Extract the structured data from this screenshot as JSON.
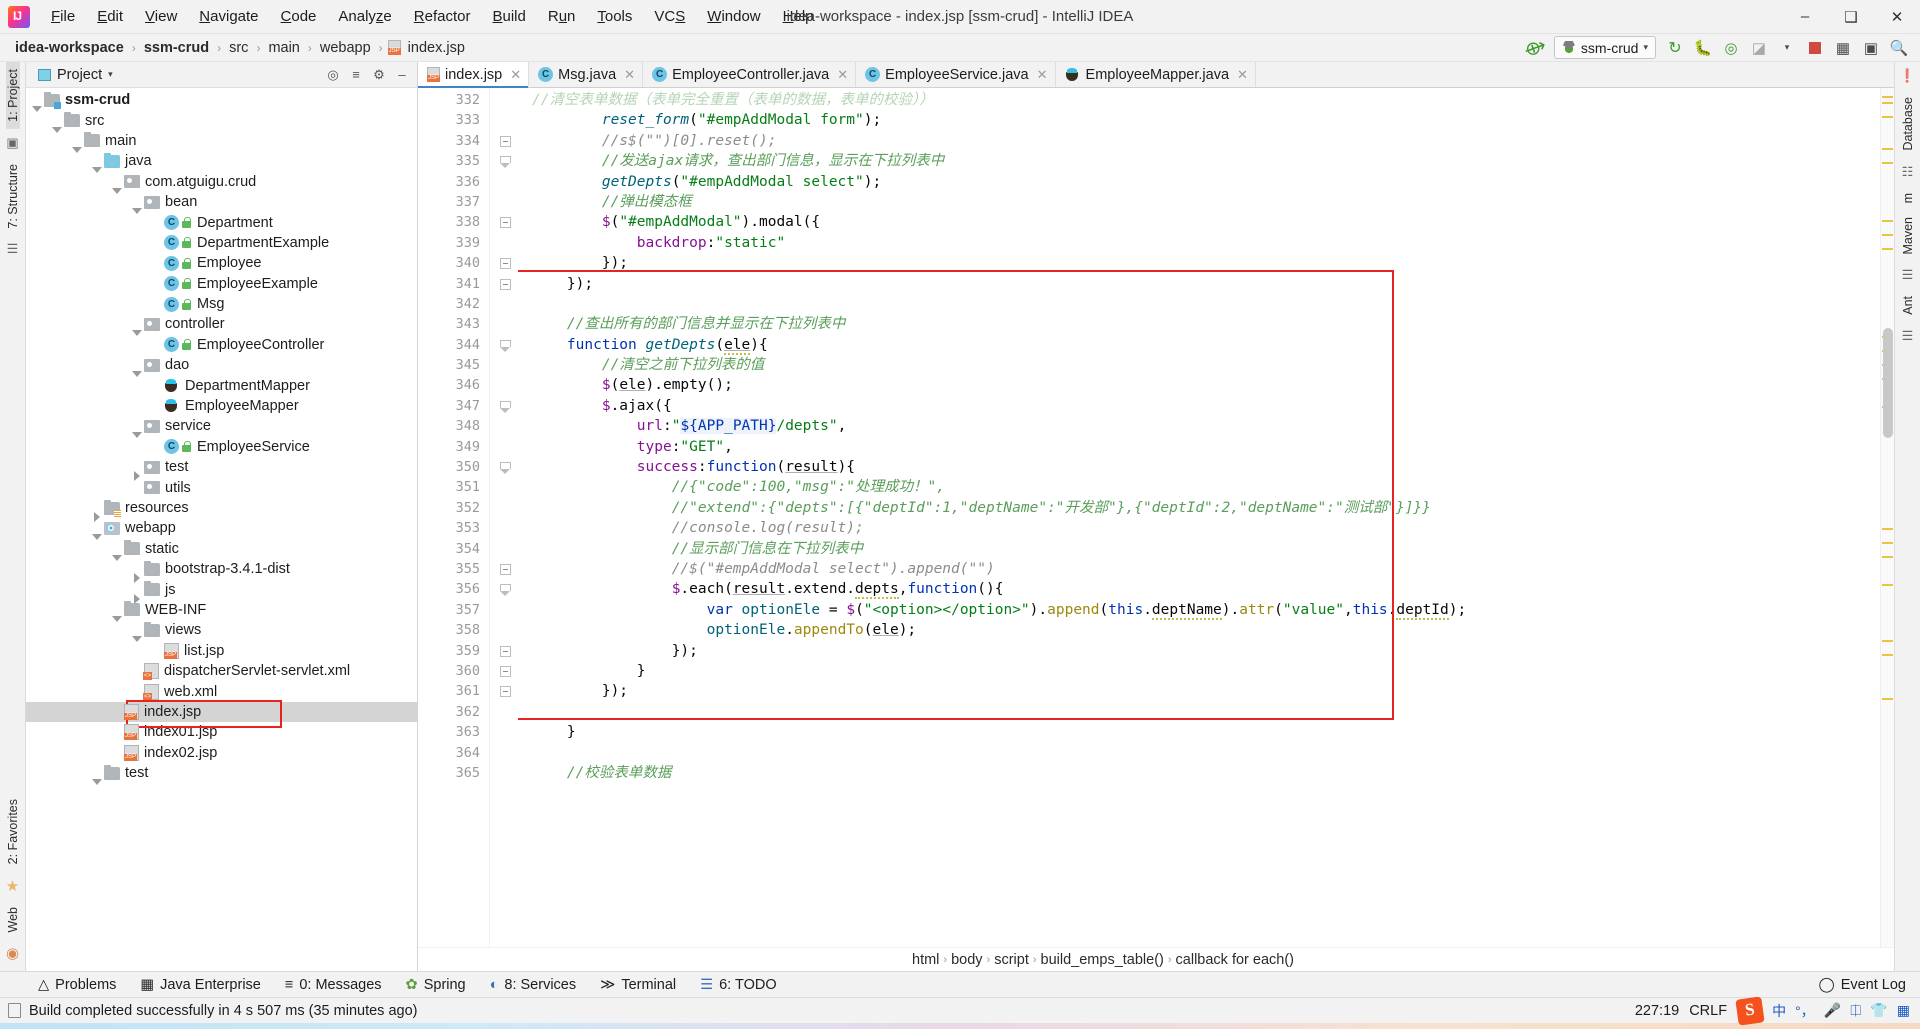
{
  "window": {
    "title": "idea-workspace - index.jsp [ssm-crud] - IntelliJ IDEA",
    "minimize": "–",
    "maximize": "❑",
    "close": "✕"
  },
  "menubar": [
    {
      "label": "File",
      "mnemonic": "F"
    },
    {
      "label": "Edit",
      "mnemonic": "E"
    },
    {
      "label": "View",
      "mnemonic": "V"
    },
    {
      "label": "Navigate",
      "mnemonic": "N"
    },
    {
      "label": "Code",
      "mnemonic": "C"
    },
    {
      "label": "Analyze",
      "mnemonic": "z"
    },
    {
      "label": "Refactor",
      "mnemonic": "R"
    },
    {
      "label": "Build",
      "mnemonic": "B"
    },
    {
      "label": "Run",
      "mnemonic": "u"
    },
    {
      "label": "Tools",
      "mnemonic": "T"
    },
    {
      "label": "VCS",
      "mnemonic": "S"
    },
    {
      "label": "Window",
      "mnemonic": "W"
    },
    {
      "label": "Help",
      "mnemonic": "H"
    }
  ],
  "breadcrumb": {
    "items": [
      "idea-workspace",
      "ssm-crud",
      "src",
      "main",
      "webapp",
      "index.jsp"
    ],
    "separator": "›"
  },
  "toolbar": {
    "run_config": "ssm-crud",
    "back_arrow_icon": "back-arrow-icon",
    "run_icon": "run-icon",
    "debug_icon": "debug-icon",
    "run_coverage_icon": "run-with-coverage-icon",
    "profile_icon": "profile-icon",
    "stop_icon": "stop-icon",
    "dropdown_caret": "▾",
    "project_structure_icon": "project-structure-icon",
    "layout_icon": "layout-icon",
    "search_icon": "search-everywhere-icon"
  },
  "left_rail": {
    "top": [
      "1: Project",
      "7: Structure"
    ],
    "bottom": [
      "2: Favorites",
      "Web"
    ]
  },
  "right_rail": {
    "items": [
      "Database",
      "m",
      "Maven",
      "Ant"
    ]
  },
  "project_panel": {
    "title": "Project",
    "caret": "▾",
    "header_icons": [
      "locate-icon",
      "collapse-all-icon",
      "settings-icon",
      "hide-icon"
    ],
    "tree": [
      {
        "depth": 0,
        "arrow": "down",
        "icon": "folder-module",
        "label": "ssm-crud",
        "bold": true
      },
      {
        "depth": 1,
        "arrow": "down",
        "icon": "folder-gray",
        "label": "src"
      },
      {
        "depth": 2,
        "arrow": "down",
        "icon": "folder-gray",
        "label": "main"
      },
      {
        "depth": 3,
        "arrow": "down",
        "icon": "folder-blue",
        "label": "java"
      },
      {
        "depth": 4,
        "arrow": "down",
        "icon": "package",
        "label": "com.atguigu.crud"
      },
      {
        "depth": 5,
        "arrow": "down",
        "icon": "package",
        "label": "bean"
      },
      {
        "depth": 6,
        "arrow": "none",
        "icon": "class",
        "label": "Department"
      },
      {
        "depth": 6,
        "arrow": "none",
        "icon": "class",
        "label": "DepartmentExample"
      },
      {
        "depth": 6,
        "arrow": "none",
        "icon": "class",
        "label": "Employee"
      },
      {
        "depth": 6,
        "arrow": "none",
        "icon": "class",
        "label": "EmployeeExample"
      },
      {
        "depth": 6,
        "arrow": "none",
        "icon": "class",
        "label": "Msg"
      },
      {
        "depth": 5,
        "arrow": "down",
        "icon": "package",
        "label": "controller"
      },
      {
        "depth": 6,
        "arrow": "none",
        "icon": "class",
        "label": "EmployeeController"
      },
      {
        "depth": 5,
        "arrow": "down",
        "icon": "package",
        "label": "dao"
      },
      {
        "depth": 6,
        "arrow": "none",
        "icon": "interface-java",
        "label": "DepartmentMapper"
      },
      {
        "depth": 6,
        "arrow": "none",
        "icon": "interface-java",
        "label": "EmployeeMapper"
      },
      {
        "depth": 5,
        "arrow": "down",
        "icon": "package",
        "label": "service"
      },
      {
        "depth": 6,
        "arrow": "none",
        "icon": "class",
        "label": "EmployeeService"
      },
      {
        "depth": 5,
        "arrow": "right",
        "icon": "package",
        "label": "test"
      },
      {
        "depth": 5,
        "arrow": "none",
        "icon": "package",
        "label": "utils"
      },
      {
        "depth": 3,
        "arrow": "right",
        "icon": "folder-res",
        "label": "resources"
      },
      {
        "depth": 3,
        "arrow": "down",
        "icon": "folder-web",
        "label": "webapp"
      },
      {
        "depth": 4,
        "arrow": "down",
        "icon": "folder-gray",
        "label": "static"
      },
      {
        "depth": 5,
        "arrow": "right",
        "icon": "folder-gray",
        "label": "bootstrap-3.4.1-dist"
      },
      {
        "depth": 5,
        "arrow": "right",
        "icon": "folder-gray",
        "label": "js"
      },
      {
        "depth": 4,
        "arrow": "down",
        "icon": "folder-gray",
        "label": "WEB-INF"
      },
      {
        "depth": 5,
        "arrow": "down",
        "icon": "folder-gray",
        "label": "views"
      },
      {
        "depth": 6,
        "arrow": "none",
        "icon": "jsp",
        "label": "list.jsp"
      },
      {
        "depth": 5,
        "arrow": "none",
        "icon": "xml",
        "label": "dispatcherServlet-servlet.xml"
      },
      {
        "depth": 5,
        "arrow": "none",
        "icon": "xml",
        "label": "web.xml"
      },
      {
        "depth": 4,
        "arrow": "none",
        "icon": "jsp",
        "label": "index.jsp",
        "selected": true,
        "boxed": true
      },
      {
        "depth": 4,
        "arrow": "none",
        "icon": "jsp",
        "label": "index01.jsp"
      },
      {
        "depth": 4,
        "arrow": "none",
        "icon": "jsp",
        "label": "index02.jsp"
      },
      {
        "depth": 3,
        "arrow": "down",
        "icon": "folder-gray",
        "label": "test"
      }
    ]
  },
  "editor_tabs": [
    {
      "label": "index.jsp",
      "icon": "jsp-file-icon",
      "active": true,
      "close": "✕"
    },
    {
      "label": "Msg.java",
      "icon": "java-class-icon",
      "active": false,
      "close": "✕"
    },
    {
      "label": "EmployeeController.java",
      "icon": "java-class-icon",
      "active": false,
      "close": "✕"
    },
    {
      "label": "EmployeeService.java",
      "icon": "java-class-icon",
      "active": false,
      "close": "✕"
    },
    {
      "label": "EmployeeMapper.java",
      "icon": "java-mapper-icon",
      "active": false,
      "close": "✕"
    }
  ],
  "editor": {
    "first_visible_line": 332,
    "lines": [
      {
        "n": 332,
        "fold": "",
        "html": "<span class=\"cmt-cn\" style=\"opacity:.45\">//清空表单数据（表单完全重置（表单的数据，表单的校验））</span>"
      },
      {
        "n": 333,
        "fold": "",
        "html": "        <span class=\"fn\" style=\"font-style:italic\">reset_form</span><span class=\"plain\">(</span><span class=\"str\">\"#empAddModal form\"</span><span class=\"plain\">);</span>"
      },
      {
        "n": 334,
        "fold": "minus",
        "html": "        <span class=\"cmt\">//s$(\"\")[0].reset();</span>"
      },
      {
        "n": 335,
        "fold": "tri",
        "html": "        <span class=\"cmt-cn\">//发送ajax请求，查出部门信息，显示在下拉列表中</span>"
      },
      {
        "n": 336,
        "fold": "",
        "html": "        <span class=\"fn\" style=\"font-style:italic\">getDepts</span><span class=\"plain\">(</span><span class=\"str\">\"#empAddModal select\"</span><span class=\"plain\">);</span>"
      },
      {
        "n": 337,
        "fold": "",
        "html": "        <span class=\"cmt-cn\">//弹出模态框</span>"
      },
      {
        "n": 338,
        "fold": "minus",
        "html": "        <span class=\"dollar\">$</span><span class=\"plain\">(</span><span class=\"str\">\"#empAddModal\"</span><span class=\"plain\">).modal({</span>"
      },
      {
        "n": 339,
        "fold": "",
        "html": "            <span class=\"prop\">backdrop</span><span class=\"plain\">:</span><span class=\"str\">\"static\"</span>"
      },
      {
        "n": 340,
        "fold": "minus",
        "html": "        <span class=\"plain\">});</span>"
      },
      {
        "n": 341,
        "fold": "minus",
        "html": "    <span class=\"plain\">});</span>"
      },
      {
        "n": 342,
        "fold": "",
        "html": ""
      },
      {
        "n": 343,
        "fold": "",
        "html": "    <span class=\"cmt-cn\">//查出所有的部门信息并显示在下拉列表中</span>"
      },
      {
        "n": 344,
        "fold": "tri",
        "html": "    <span class=\"kw\">function</span> <span class=\"fn\" style=\"font-style:italic\">getDepts</span><span class=\"plain\">(</span><span class=\"var-u wavy plain\">ele</span><span class=\"plain\">){</span>"
      },
      {
        "n": 345,
        "fold": "",
        "html": "        <span class=\"cmt-cn\">//清空之前下拉列表的值</span>"
      },
      {
        "n": 346,
        "fold": "",
        "html": "        <span class=\"dollar\">$</span><span class=\"plain\">(</span><span class=\"var-u plain\">ele</span><span class=\"plain\">).empty();</span>"
      },
      {
        "n": 347,
        "fold": "tri",
        "html": "        <span class=\"dollar\">$</span><span class=\"plain\">.ajax({</span>"
      },
      {
        "n": 348,
        "fold": "",
        "html": "            <span class=\"prop\">url</span><span class=\"plain\">:</span><span class=\"str\">\"</span><span class=\"tmpl\">${APP_PATH}</span><span class=\"str\">/depts\"</span><span class=\"plain\">,</span>"
      },
      {
        "n": 349,
        "fold": "",
        "html": "            <span class=\"prop\">type</span><span class=\"plain\">:</span><span class=\"str\">\"GET\"</span><span class=\"plain\">,</span>"
      },
      {
        "n": 350,
        "fold": "tri",
        "html": "            <span class=\"prop\">success</span><span class=\"plain\">:</span><span class=\"kw\">function</span><span class=\"plain\">(</span><span class=\"var-u plain\">result</span><span class=\"plain\">){</span>"
      },
      {
        "n": 351,
        "fold": "",
        "html": "                <span class=\"cmt-cn\">//{\"code\":100,\"msg\":\"处理成功！\",</span>"
      },
      {
        "n": 352,
        "fold": "",
        "html": "                <span class=\"cmt-cn\">//\"extend\":{\"depts\":[{\"deptId\":1,\"deptName\":\"开发部\"},{\"deptId\":2,\"deptName\":\"测试部\"}]}}</span>"
      },
      {
        "n": 353,
        "fold": "",
        "html": "                <span class=\"cmt\">//console.log(result);</span>"
      },
      {
        "n": 354,
        "fold": "",
        "html": "                <span class=\"cmt-cn\">//显示部门信息在下拉列表中</span>"
      },
      {
        "n": 355,
        "fold": "minus",
        "html": "                <span class=\"cmt\">//$(\"#empAddModal select\").append(\"\")</span>"
      },
      {
        "n": 356,
        "fold": "tri",
        "html": "                <span class=\"dollar\">$</span><span class=\"plain\">.each(</span><span class=\"var-u plain\">result</span><span class=\"plain\">.extend.</span><span class=\"wavy plain\">depts</span><span class=\"plain\">,</span><span class=\"kw\">function</span><span class=\"plain\">(){</span>"
      },
      {
        "n": 357,
        "fold": "",
        "html": "                    <span class=\"kw\">var</span> <span class=\"fn\">optionEle</span> <span class=\"plain\">= </span><span class=\"dollar\">$</span><span class=\"plain\">(</span><span class=\"str\">\"&lt;option&gt;&lt;/option&gt;\"</span><span class=\"plain\">).</span><span class=\"el\">append</span><span class=\"plain\">(</span><span class=\"kw\">this</span><span class=\"plain\">.</span><span class=\"wavy plain\">deptName</span><span class=\"plain\">).</span><span class=\"el\">attr</span><span class=\"plain\">(</span><span class=\"str\">\"value\"</span><span class=\"plain\">,</span><span class=\"kw\">this</span><span class=\"plain\">.</span><span class=\"wavy plain\">deptId</span><span class=\"plain\">);</span>"
      },
      {
        "n": 358,
        "fold": "",
        "html": "                    <span class=\"fn\">optionEle</span><span class=\"plain\">.</span><span class=\"el\">appendTo</span><span class=\"plain\">(</span><span class=\"var-u plain\">ele</span><span class=\"plain\">);</span>"
      },
      {
        "n": 359,
        "fold": "minus",
        "html": "                <span class=\"plain\">});</span>"
      },
      {
        "n": 360,
        "fold": "minus",
        "html": "            <span class=\"plain\">}</span>"
      },
      {
        "n": 361,
        "fold": "minus",
        "html": "        <span class=\"plain\">});</span>"
      },
      {
        "n": 362,
        "fold": "",
        "html": ""
      },
      {
        "n": 363,
        "fold": "",
        "html": "    <span class=\"plain\">}</span>"
      },
      {
        "n": 364,
        "fold": "",
        "html": ""
      },
      {
        "n": 365,
        "fold": "",
        "html": "    <span class=\"cmt-cn\">//校验表单数据</span>"
      }
    ],
    "breadcrumb": [
      "html",
      "body",
      "script",
      "build_emps_table()",
      "callback for each()"
    ],
    "breadcrumb_sep": "›"
  },
  "bottom_toolwindows": [
    {
      "label": "Problems",
      "icon": "warning-icon",
      "mnemonic": ""
    },
    {
      "label": "Java Enterprise",
      "icon": "java-enterprise-icon",
      "mnemonic": ""
    },
    {
      "label": "0: Messages",
      "icon": "messages-icon",
      "mnemonic": "0"
    },
    {
      "label": "Spring",
      "icon": "spring-leaf-icon",
      "mnemonic": ""
    },
    {
      "label": "8: Services",
      "icon": "services-icon",
      "mnemonic": "8"
    },
    {
      "label": "Terminal",
      "icon": "terminal-icon",
      "mnemonic": ""
    },
    {
      "label": "6: TODO",
      "icon": "todo-icon",
      "mnemonic": "6"
    }
  ],
  "event_log": {
    "label": "Event Log",
    "icon": "event-log-icon"
  },
  "status": {
    "message": "Build completed successfully in 4 s 507 ms (35 minutes ago)",
    "caret_position": "227:19",
    "line_separator": "CRLF",
    "tray": [
      "sogou-icon",
      "中",
      "°，",
      "mic-icon",
      "keyboard-icon",
      "skin-icon",
      "apps-icon"
    ]
  }
}
